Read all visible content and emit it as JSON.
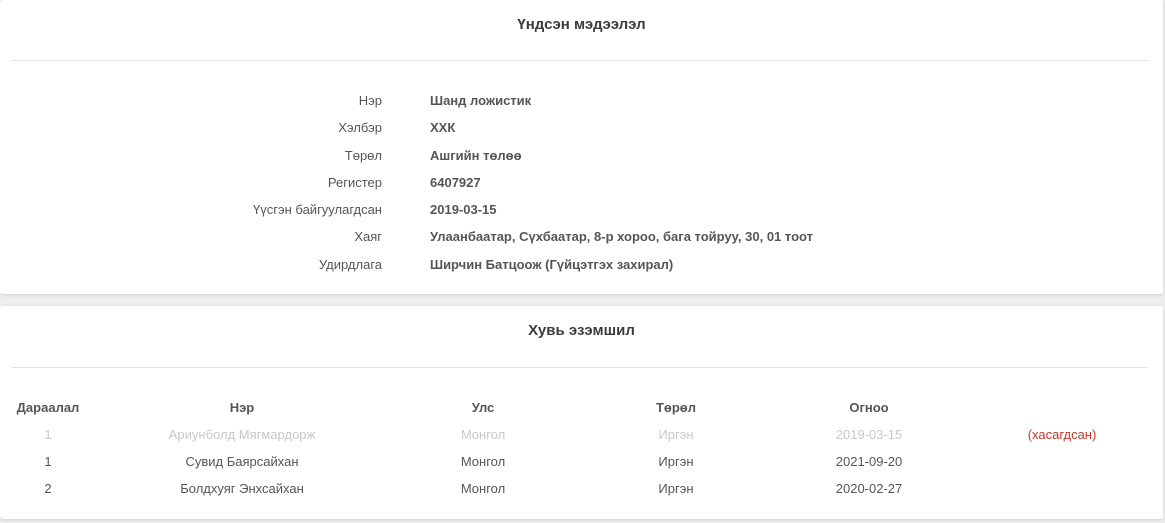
{
  "basic_info": {
    "title": "Үндсэн мэдээлэл",
    "rows": [
      {
        "label": "Нэр",
        "value": "Шанд ложистик"
      },
      {
        "label": "Хэлбэр",
        "value": "ХХК"
      },
      {
        "label": "Төрөл",
        "value": "Ашгийн төлөө"
      },
      {
        "label": "Регистер",
        "value": "6407927"
      },
      {
        "label": "Үүсгэн байгуулагдсан",
        "value": "2019-03-15"
      },
      {
        "label": "Хаяг",
        "value": "Улаанбаатар, Сүхбаатар, 8-р хороо, бага тойруу, 30, 01 тоот"
      },
      {
        "label": "Удирдлага",
        "value": "Ширчин Батцоож (Гүйцэтгэх захирал)"
      }
    ]
  },
  "shareholding": {
    "title": "Хувь эзэмшил",
    "headers": {
      "order": "Дараалал",
      "name": "Нэр",
      "country": "Улс",
      "type": "Төрөл",
      "date": "Огноо"
    },
    "rows": [
      {
        "order": "1",
        "name": "Ариунболд Мягмардорж",
        "country": "Монгол",
        "type": "Иргэн",
        "date": "2019-03-15",
        "status": "(хасагдсан)",
        "removed": true
      },
      {
        "order": "1",
        "name": "Сувид Баярсайхан",
        "country": "Монгол",
        "type": "Иргэн",
        "date": "2021-09-20",
        "status": "",
        "removed": false
      },
      {
        "order": "2",
        "name": "Болдхуяг Энхсайхан",
        "country": "Монгол",
        "type": "Иргэн",
        "date": "2020-02-27",
        "status": "",
        "removed": false
      }
    ]
  },
  "colors": {
    "removed_text": "#c8c8c8",
    "status_removed": "#c0392b",
    "card_bg": "#ffffff",
    "page_bg": "#eeeeee"
  }
}
